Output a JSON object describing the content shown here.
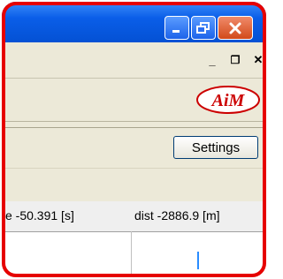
{
  "window": {
    "controls": {
      "minimize_icon": "minimize-icon",
      "restore_icon": "restore-icon",
      "close_icon": "close-icon"
    },
    "colors": {
      "titlebar": "#0a5ee8",
      "close": "#d24a1a",
      "highlight_border": "#e60000"
    }
  },
  "mdi": {
    "minimize_glyph": "_",
    "restore_glyph": "❐",
    "close_glyph": "✕"
  },
  "toolbar": {
    "logo_text": "AiM",
    "settings_label": "Settings"
  },
  "readout": {
    "time_text": "e -50.391 [s]",
    "dist_text": "dist -2886.9 [m]"
  }
}
